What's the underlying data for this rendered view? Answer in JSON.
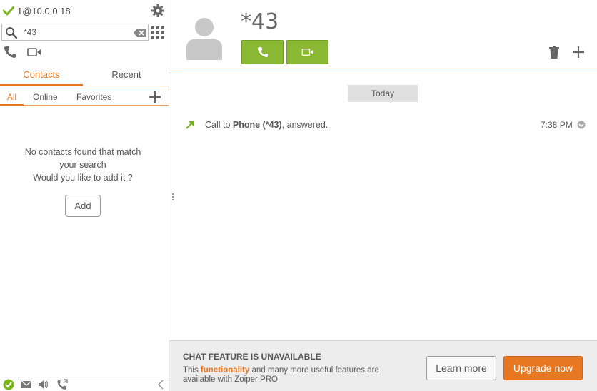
{
  "account": {
    "label": "1@10.0.0.18",
    "status_icon": "check-icon"
  },
  "search": {
    "value": "*43",
    "placeholder": ""
  },
  "tabs": [
    {
      "label": "Contacts",
      "active": true
    },
    {
      "label": "Recent",
      "active": false
    }
  ],
  "filters": [
    {
      "label": "All",
      "active": true
    },
    {
      "label": "Online",
      "active": false
    },
    {
      "label": "Favorites",
      "active": false
    }
  ],
  "empty_state": {
    "line1": "No contacts found that match",
    "line2": "your search",
    "line3": "Would you like to add it ?",
    "add_label": "Add"
  },
  "contact": {
    "name": "*43"
  },
  "history": {
    "day_label": "Today",
    "entries": [
      {
        "prefix": "Call to ",
        "target": "Phone (*43)",
        "suffix": ", answered.",
        "time": "7:38 PM"
      }
    ]
  },
  "promo": {
    "title": "CHAT FEATURE IS UNAVAILABLE",
    "text_before": "This ",
    "highlight": "functionality",
    "text_after": " and many more useful features are available with Zoiper PRO",
    "learn_label": "Learn more",
    "upgrade_label": "Upgrade now"
  },
  "colors": {
    "accent": "#e87722",
    "call_green": "#8ab833",
    "status_green": "#7ab51d"
  }
}
